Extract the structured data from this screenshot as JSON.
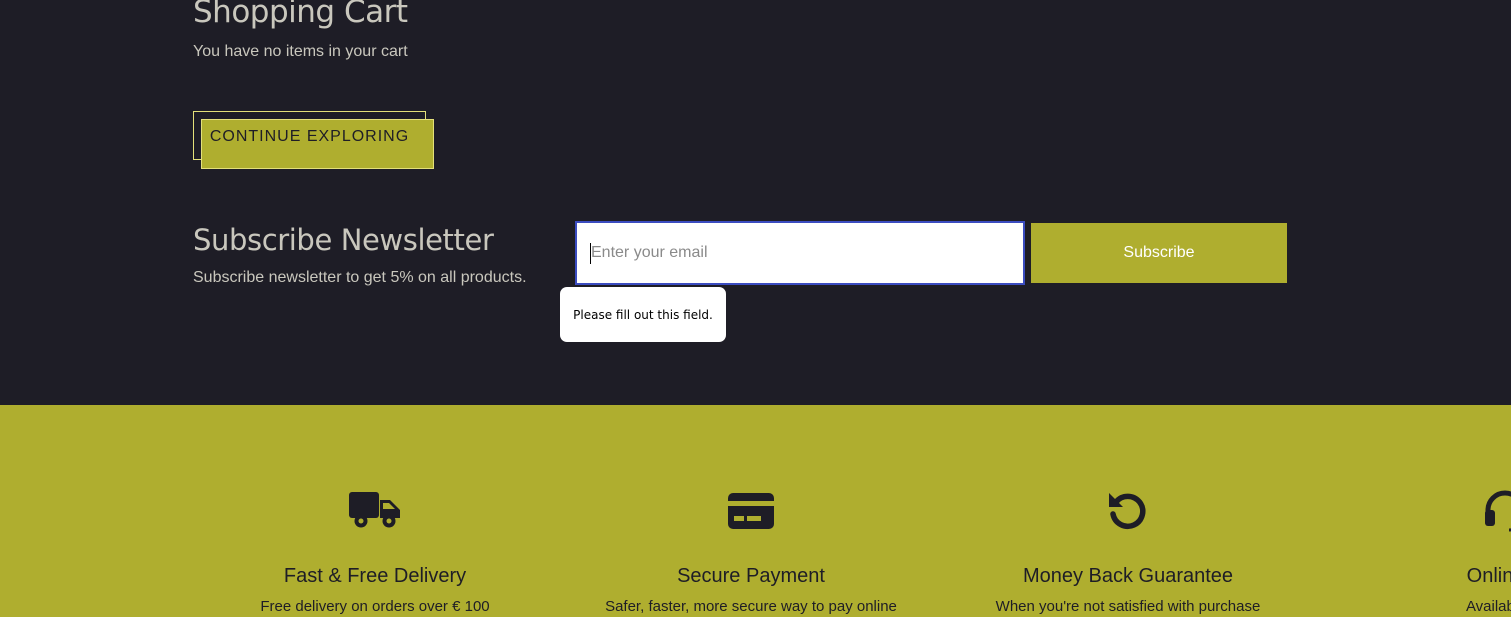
{
  "cart": {
    "title": "Shopping Cart",
    "empty_message": "You have no items in your cart",
    "continue_label": "CONTINUE EXPLORING"
  },
  "newsletter": {
    "title": "Subscribe Newsletter",
    "subtitle": "Subscribe newsletter to get 5% on all products.",
    "email_placeholder": "Enter your email",
    "email_value": "",
    "subscribe_label": "Subscribe",
    "validation_message": "Please fill out this field."
  },
  "features": [
    {
      "icon": "truck-icon",
      "title": "Fast & Free Delivery",
      "description": "Free delivery on orders over € 100"
    },
    {
      "icon": "credit-card-icon",
      "title": "Secure Payment",
      "description": "Safer, faster, more secure way to pay online"
    },
    {
      "icon": "rotate-left-icon",
      "title": "Money Back Guarantee",
      "description": "When you're not satisfied with purchase"
    },
    {
      "icon": "headset-icon",
      "title": "Online S",
      "description": "Available or"
    }
  ],
  "colors": {
    "background_dark": "#1e1d26",
    "accent_olive": "#afae2f",
    "text_light": "#c9c7bd",
    "focus_border": "#3b4cc0"
  }
}
